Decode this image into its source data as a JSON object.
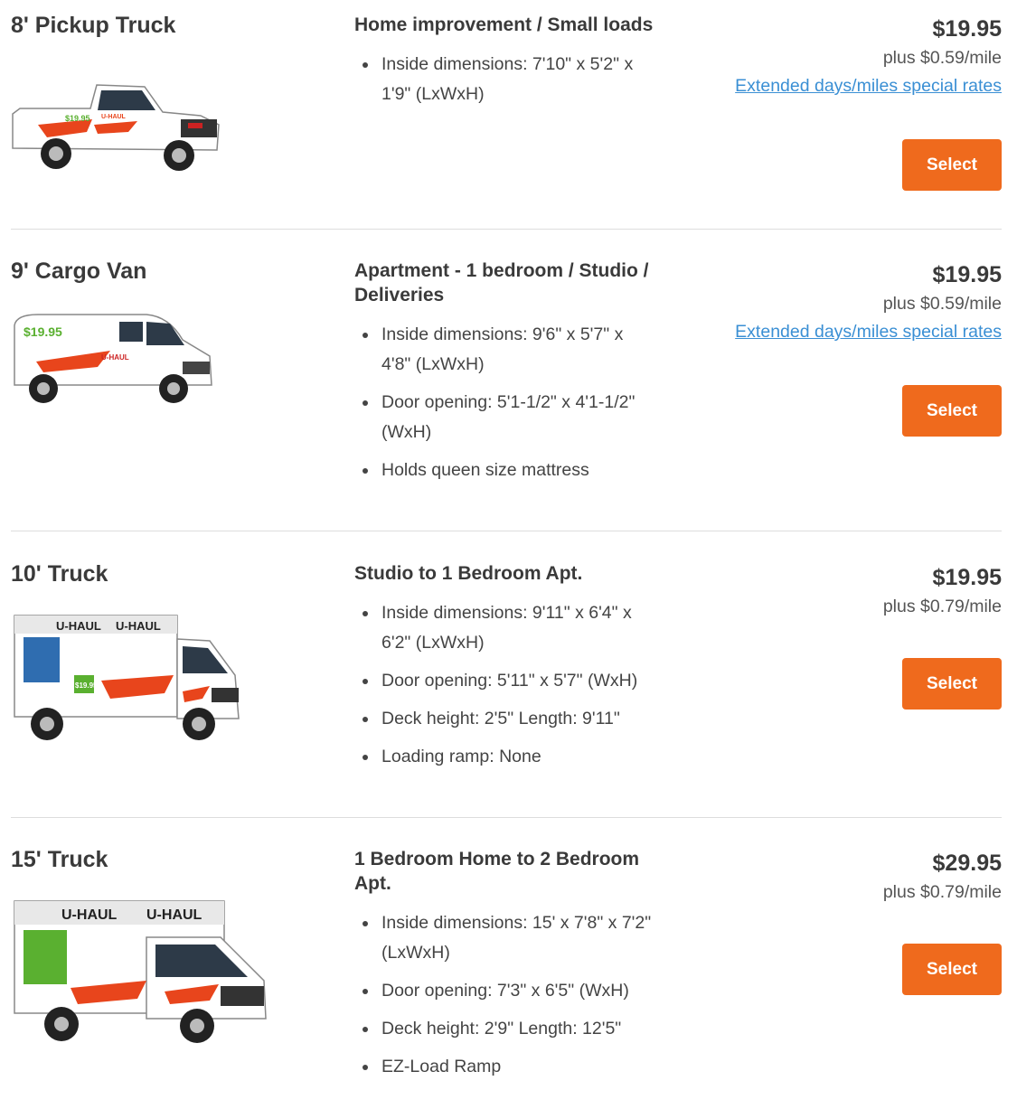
{
  "vehicles": [
    {
      "name": "8' Pickup Truck",
      "title": "Home improvement / Small loads",
      "features": [
        "Inside dimensions: 7'10\" x 5'2\" x 1'9\" (LxWxH)"
      ],
      "price": "$19.95",
      "mileage": "plus $0.59/mile",
      "extended_link": "Extended days/miles special rates",
      "select_label": "Select"
    },
    {
      "name": "9' Cargo Van",
      "title": "Apartment - 1 bedroom / Studio / Deliveries",
      "features": [
        "Inside dimensions: 9'6\" x 5'7\" x 4'8\" (LxWxH)",
        "Door opening: 5'1-1/2\" x 4'1-1/2\" (WxH)",
        "Holds queen size mattress"
      ],
      "price": "$19.95",
      "mileage": "plus $0.59/mile",
      "extended_link": "Extended days/miles special rates",
      "select_label": "Select"
    },
    {
      "name": "10' Truck",
      "title": "Studio to 1 Bedroom Apt.",
      "features": [
        "Inside dimensions: 9'11\" x 6'4\" x 6'2\" (LxWxH)",
        "Door opening: 5'11\" x 5'7\" (WxH)",
        "Deck height: 2'5\" Length: 9'11\"",
        "Loading ramp: None"
      ],
      "price": "$19.95",
      "mileage": "plus $0.79/mile",
      "select_label": "Select"
    },
    {
      "name": "15' Truck",
      "title": "1 Bedroom Home to 2 Bedroom Apt.",
      "features": [
        "Inside dimensions: 15' x 7'8\" x 7'2\" (LxWxH)",
        "Door opening: 7'3\" x 6'5\" (WxH)",
        "Deck height: 2'9\" Length: 12'5\"",
        "EZ-Load Ramp"
      ],
      "price": "$29.95",
      "mileage": "plus $0.79/mile",
      "select_label": "Select"
    }
  ],
  "vehicle_decals": {
    "pickup": [
      "U-HAUL",
      "$19.95"
    ],
    "van": [
      "$19.95",
      "U-HAUL"
    ],
    "truck10": [
      "U-HAUL",
      "U-HAUL",
      "$19.95"
    ],
    "truck15": [
      "U-HAUL",
      "U-HAUL"
    ]
  },
  "colors": {
    "accent": "#ef6a1d",
    "link": "#3a8fd4",
    "text": "#333333",
    "divider": "#dddddd",
    "uhaul_orange": "#e8451c",
    "decal_green": "#5ab030"
  }
}
